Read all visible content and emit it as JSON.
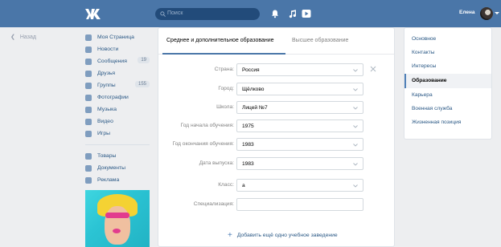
{
  "topbar": {
    "search_placeholder": "Поиск",
    "user_name": "Елена",
    "icons": [
      "bell-icon",
      "music-icon",
      "play-icon"
    ]
  },
  "back_label": "Назад",
  "nav": {
    "items": [
      {
        "label": "Моя Страница",
        "icon": "home-icon"
      },
      {
        "label": "Новости",
        "icon": "news-icon"
      },
      {
        "label": "Сообщения",
        "icon": "messages-icon",
        "count": "19"
      },
      {
        "label": "Друзья",
        "icon": "friends-icon"
      },
      {
        "label": "Группы",
        "icon": "groups-icon",
        "count": "155"
      },
      {
        "label": "Фотографии",
        "icon": "photos-icon"
      },
      {
        "label": "Музыка",
        "icon": "music-icon"
      },
      {
        "label": "Видео",
        "icon": "video-icon"
      },
      {
        "label": "Игры",
        "icon": "games-icon"
      }
    ],
    "items2": [
      {
        "label": "Товары",
        "icon": "goods-icon"
      },
      {
        "label": "Документы",
        "icon": "documents-icon"
      },
      {
        "label": "Реклама",
        "icon": "ads-icon"
      }
    ]
  },
  "tabs": [
    {
      "label": "Среднее и дополнительное образование",
      "active": true
    },
    {
      "label": "Высшее образование",
      "active": false
    }
  ],
  "form": {
    "country": {
      "label": "Страна:",
      "value": "Россия"
    },
    "city": {
      "label": "Город:",
      "value": "Щёлково"
    },
    "school": {
      "label": "Школа:",
      "value": "Лицей №7"
    },
    "start_year": {
      "label": "Год начала обучения:",
      "value": "1975"
    },
    "end_year": {
      "label": "Год окончания обучения:",
      "value": "1983"
    },
    "grad_date": {
      "label": "Дата выпуска:",
      "value": "1983"
    },
    "class": {
      "label": "Класс:",
      "value": "а"
    },
    "specialization": {
      "label": "Специализация:",
      "value": ""
    }
  },
  "add_school_label": "Добавить ещё одно учебное заведение",
  "right_menu": [
    {
      "label": "Основное",
      "active": false
    },
    {
      "label": "Контакты",
      "active": false
    },
    {
      "label": "Интересы",
      "active": false
    },
    {
      "label": "Образование",
      "active": true
    },
    {
      "label": "Карьера",
      "active": false
    },
    {
      "label": "Военная служба",
      "active": false
    },
    {
      "label": "Жизненная позиция",
      "active": false
    }
  ],
  "colors": {
    "header": "#4a76a8",
    "accent": "#5181b8",
    "background": "#edeef0"
  }
}
